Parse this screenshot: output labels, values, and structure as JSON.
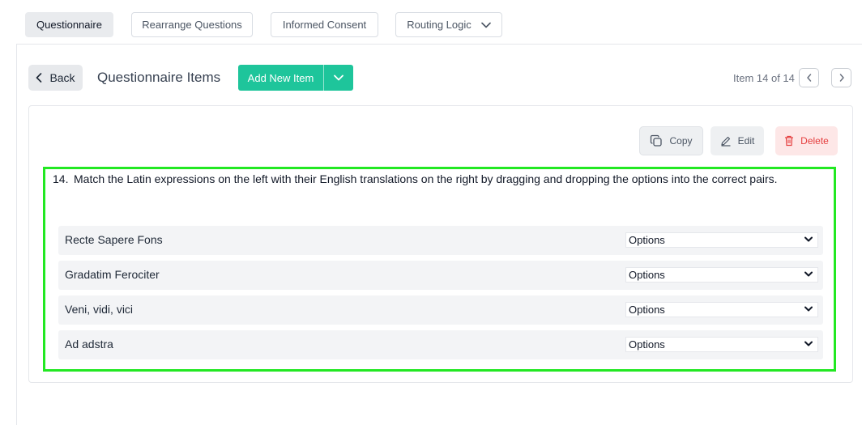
{
  "tabs": [
    {
      "label": "Questionnaire",
      "active": true
    },
    {
      "label": "Rearrange Questions",
      "active": false
    },
    {
      "label": "Informed Consent",
      "active": false
    },
    {
      "label": "Routing Logic",
      "active": false
    }
  ],
  "toolbar": {
    "back_label": "Back",
    "title": "Questionnaire Items",
    "add_label": "Add New Item",
    "pager_text": "Item 14 of 14"
  },
  "actions": {
    "copy_label": "Copy",
    "edit_label": "Edit",
    "delete_label": "Delete"
  },
  "question": {
    "number": "14.",
    "text": "Match the Latin expressions on the left with their English translations on the right by dragging and dropping the options into the correct pairs.",
    "rows": [
      {
        "label": "Recte Sapere Fons",
        "selected": "Options"
      },
      {
        "label": "Gradatim Ferociter",
        "selected": "Options"
      },
      {
        "label": "Veni, vidi, vici",
        "selected": "Options"
      },
      {
        "label": "Ad adstra",
        "selected": "Options"
      }
    ]
  },
  "colors": {
    "accent": "#1ec59b",
    "delete": "#e53e3e",
    "highlight": "#22e822"
  },
  "icons": {
    "back": "chevron-left-icon",
    "add_toggle": "chevron-down-icon",
    "prev": "chevron-left-icon",
    "next": "chevron-right-icon",
    "copy": "copy-icon",
    "edit": "pencil-icon",
    "delete": "trash-icon"
  }
}
